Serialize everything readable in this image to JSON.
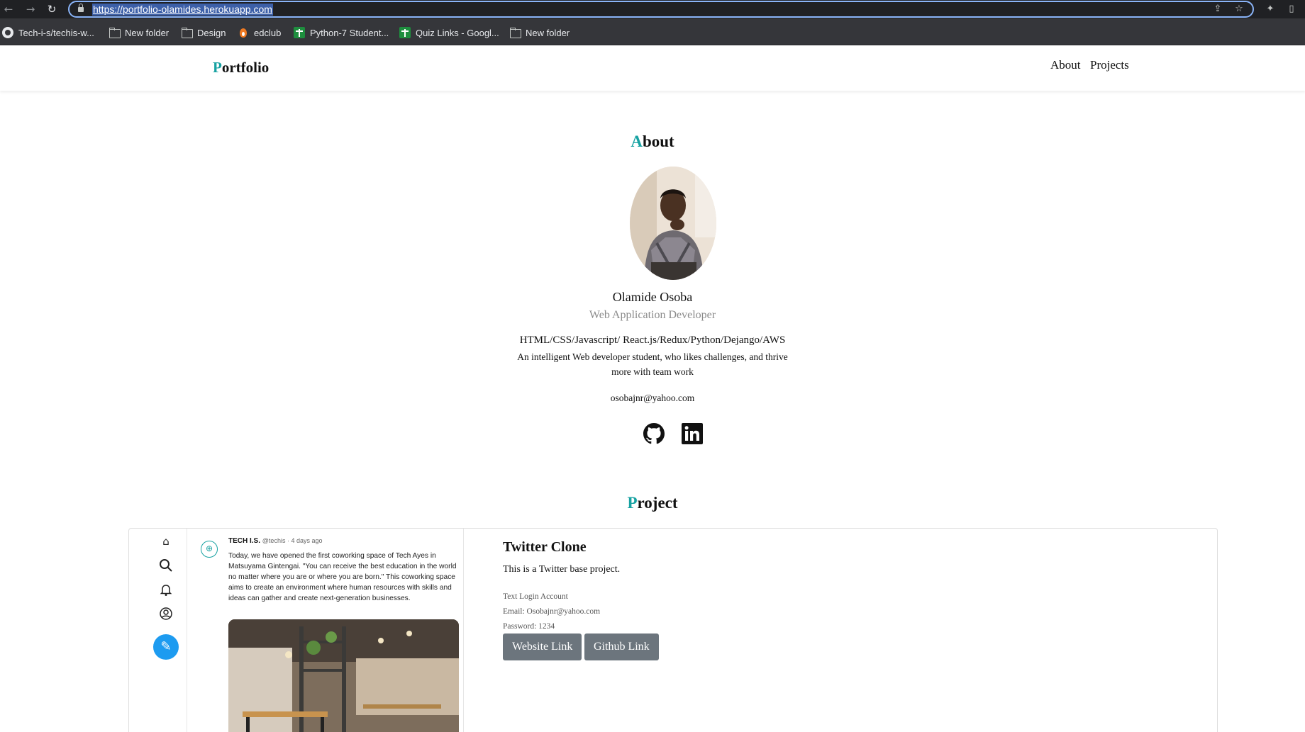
{
  "browser": {
    "url": "https://portfolio-olamides.herokuapp.com",
    "back_glyph": "←",
    "forward_glyph": "→",
    "reload_glyph": "↻",
    "share_glyph": "⇪",
    "star_glyph": "☆",
    "extensions_glyph": "✦",
    "sidepanel_glyph": "▯",
    "bookmarks": [
      {
        "label": "Tech-i-s/techis-w...",
        "icon": "github-icon"
      },
      {
        "label": "New folder",
        "icon": "folder-icon"
      },
      {
        "label": "Design",
        "icon": "folder-icon"
      },
      {
        "label": "edclub",
        "icon": "flame-icon"
      },
      {
        "label": "Python-7 Student...",
        "icon": "sheets-icon"
      },
      {
        "label": "Quiz Links - Googl...",
        "icon": "sheets-icon"
      },
      {
        "label": "New folder",
        "icon": "folder-icon"
      }
    ]
  },
  "header": {
    "brand_first": "P",
    "brand_rest": "ortfolio",
    "nav": [
      {
        "label": "About"
      },
      {
        "label": "Projects"
      }
    ]
  },
  "about": {
    "title_first": "A",
    "title_rest": "bout",
    "name": "Olamide Osoba",
    "role": "Web Application Developer",
    "skills": "HTML/CSS/Javascript/ React.js/Redux/Python/Dejango/AWS",
    "bio_line1": "An intelligent Web developer student, who likes challenges, and thrive",
    "bio_line2": "more with team work",
    "email": "osobajnr@yahoo.com",
    "social": [
      {
        "name": "github-icon"
      },
      {
        "name": "linkedin-icon"
      }
    ]
  },
  "projects": {
    "title_first": "P",
    "title_rest": "roject",
    "items": [
      {
        "title": "Twitter Clone",
        "description": "This is a Twitter base project.",
        "login_heading": "Text Login Account",
        "email": "Email: Osobajnr@yahoo.com",
        "password": "Password: 1234",
        "website_label": "Website Link",
        "github_label": "Github Link",
        "screenshot": {
          "icons": [
            "home-icon",
            "search-icon",
            "bell-icon",
            "profile-icon"
          ],
          "user": "TECH I.S.",
          "meta": "@techis · 4 days ago",
          "text": "Today, we have opened the first coworking space of Tech Ayes in Matsuyama Gintengai. \"You can receive the best education in the world no matter where you are or where you are born.\" This coworking space aims to create an environment where human resources with skills and ideas can gather and create next-generation businesses."
        }
      }
    ]
  },
  "colors": {
    "accent": "#17a2a2",
    "button": "#6c757d",
    "compose": "#1d9bf0"
  }
}
